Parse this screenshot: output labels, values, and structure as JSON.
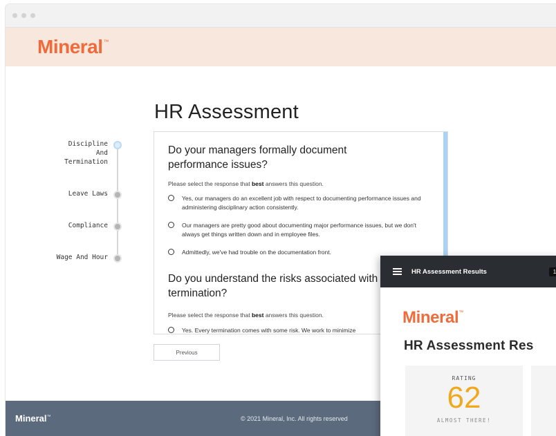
{
  "brand": {
    "logo": "Mineral",
    "tm": "™"
  },
  "page": {
    "title": "HR Assessment"
  },
  "steps": [
    {
      "label": "Discipline And Termination",
      "state": "active"
    },
    {
      "label": "Leave Laws",
      "state": "pending"
    },
    {
      "label": "Compliance",
      "state": "pending"
    },
    {
      "label": "Wage And Hour",
      "state": "pending"
    }
  ],
  "questions": [
    {
      "text": "Do your managers formally document performance issues?",
      "hint_prefix": "Please select the response that ",
      "hint_bold": "best",
      "hint_suffix": " answers this question.",
      "options": [
        "Yes, our managers do an excellent job with respect to documenting performance issues and administering disciplinary action consistently.",
        "Our managers are pretty good about documenting major performance issues, but we don't always get things written down and in employee files.",
        "Admittedly, we've had trouble on the documentation front."
      ]
    },
    {
      "text": "Do you understand the risks associated with termination?",
      "hint_prefix": "Please select the response that ",
      "hint_bold": "best",
      "hint_suffix": " answers this question.",
      "options": [
        "Yes. Every termination comes with some risk. We work to minimize"
      ]
    }
  ],
  "nav": {
    "previous_label": "Previous"
  },
  "footer": {
    "logo": "Mineral",
    "tm": "™",
    "copyright": "© 2021 Mineral, Inc. All rights reserved"
  },
  "results": {
    "bar_title": "HR Assessment Results",
    "badge": "1",
    "logo": "Mineral",
    "tm": "™",
    "heading": "HR Assessment Res",
    "rating_label": "RATING",
    "rating_value": "62",
    "rating_caption": "ALMOST THERE!"
  },
  "colors": {
    "brand_orange": "#ef6b3b",
    "rating_yellow": "#f0a91f",
    "footer": "#5b6b7d",
    "topbar": "#f7e7dc"
  }
}
